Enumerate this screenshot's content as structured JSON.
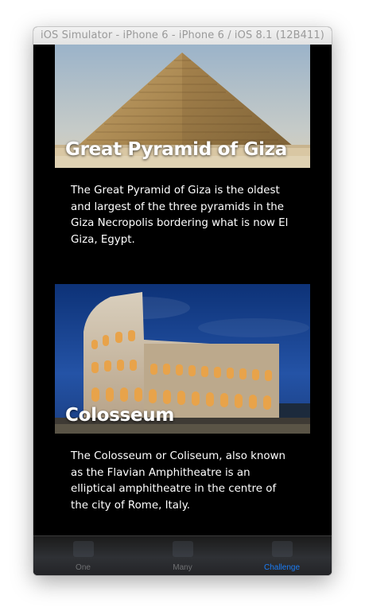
{
  "window": {
    "title": "iOS Simulator - iPhone 6 - iPhone 6 / iOS 8.1 (12B411)"
  },
  "cards": [
    {
      "title": "Great Pyramid of Giza",
      "description": "The Great Pyramid of Giza is the oldest and largest of the three pyramids in the Giza Necropolis bordering what is now El Giza, Egypt.",
      "image_icon": "pyramid-photo"
    },
    {
      "title": "Colosseum",
      "description": "The Colosseum or Coliseum, also known as the Flavian Amphitheatre is an elliptical amphitheatre in the centre of the city of Rome, Italy.",
      "image_icon": "colosseum-photo"
    }
  ],
  "tabbar": {
    "tabs": [
      {
        "label": "One",
        "active": false
      },
      {
        "label": "Many",
        "active": false
      },
      {
        "label": "Challenge",
        "active": true
      }
    ],
    "active_color": "#1b7cf5",
    "inactive_color": "#6f7073"
  }
}
